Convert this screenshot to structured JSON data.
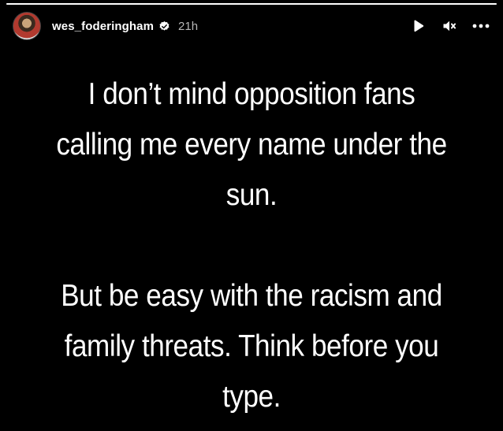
{
  "story": {
    "progress": 1.0,
    "header": {
      "username": "wes_foderingham",
      "verified": true,
      "time": "21h"
    },
    "controls": {
      "play_icon": "play-icon",
      "mute_icon": "muted-speaker-icon",
      "more_icon": "more-options-icon"
    },
    "text": {
      "paragraph1": {
        "line1": "I don’t mind opposition fans",
        "line2": "calling  me every name under the",
        "line3": "sun."
      },
      "paragraph2": {
        "line1": "But be easy with the racism and",
        "line2": "family threats. Think before you",
        "line3": "type."
      }
    }
  },
  "colors": {
    "background": "#000000",
    "text": "#ffffff",
    "muted_text": "#b8b8b8"
  }
}
